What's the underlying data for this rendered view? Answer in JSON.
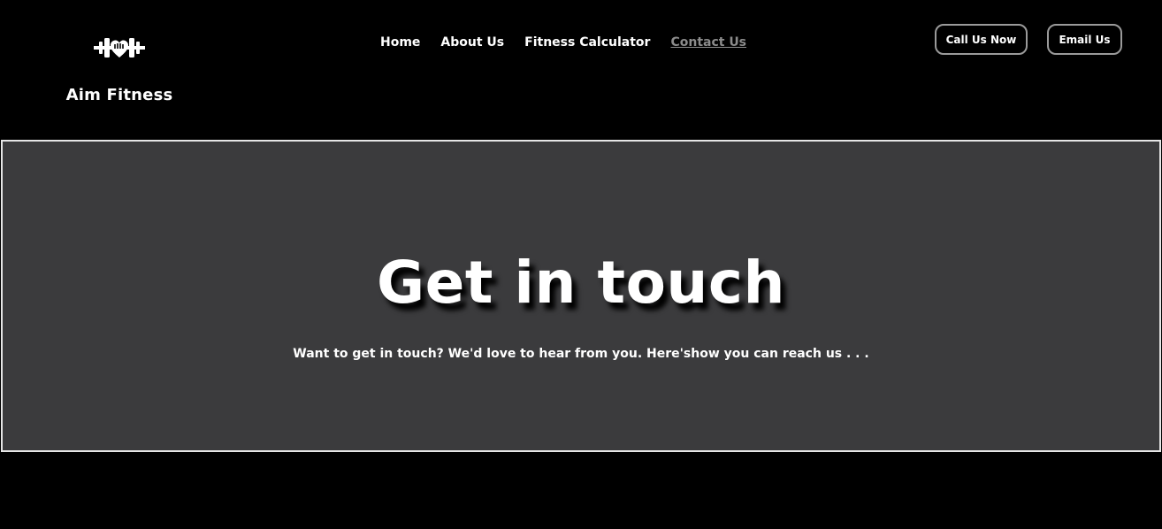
{
  "brand": {
    "name": "Aim Fitness",
    "logo_icon": "dumbbell-heart-icon"
  },
  "nav": {
    "items": [
      {
        "label": "Home",
        "active": false
      },
      {
        "label": "About Us",
        "active": false
      },
      {
        "label": "Fitness Calculator",
        "active": false
      },
      {
        "label": "Contact Us",
        "active": true
      }
    ]
  },
  "actions": {
    "call_label": "Call Us Now",
    "email_label": "Email Us"
  },
  "hero": {
    "title": "Get in touch",
    "subtitle": "Want to get in touch? We'd love to hear from you. Here'show you can reach us . . ."
  },
  "colors": {
    "page_background": "#000000",
    "hero_background": "#3b3b3d",
    "hero_border": "#e6e6e6",
    "text": "#ffffff",
    "active_nav": "#8c8c8c",
    "button_border": "#9a9a9a"
  }
}
